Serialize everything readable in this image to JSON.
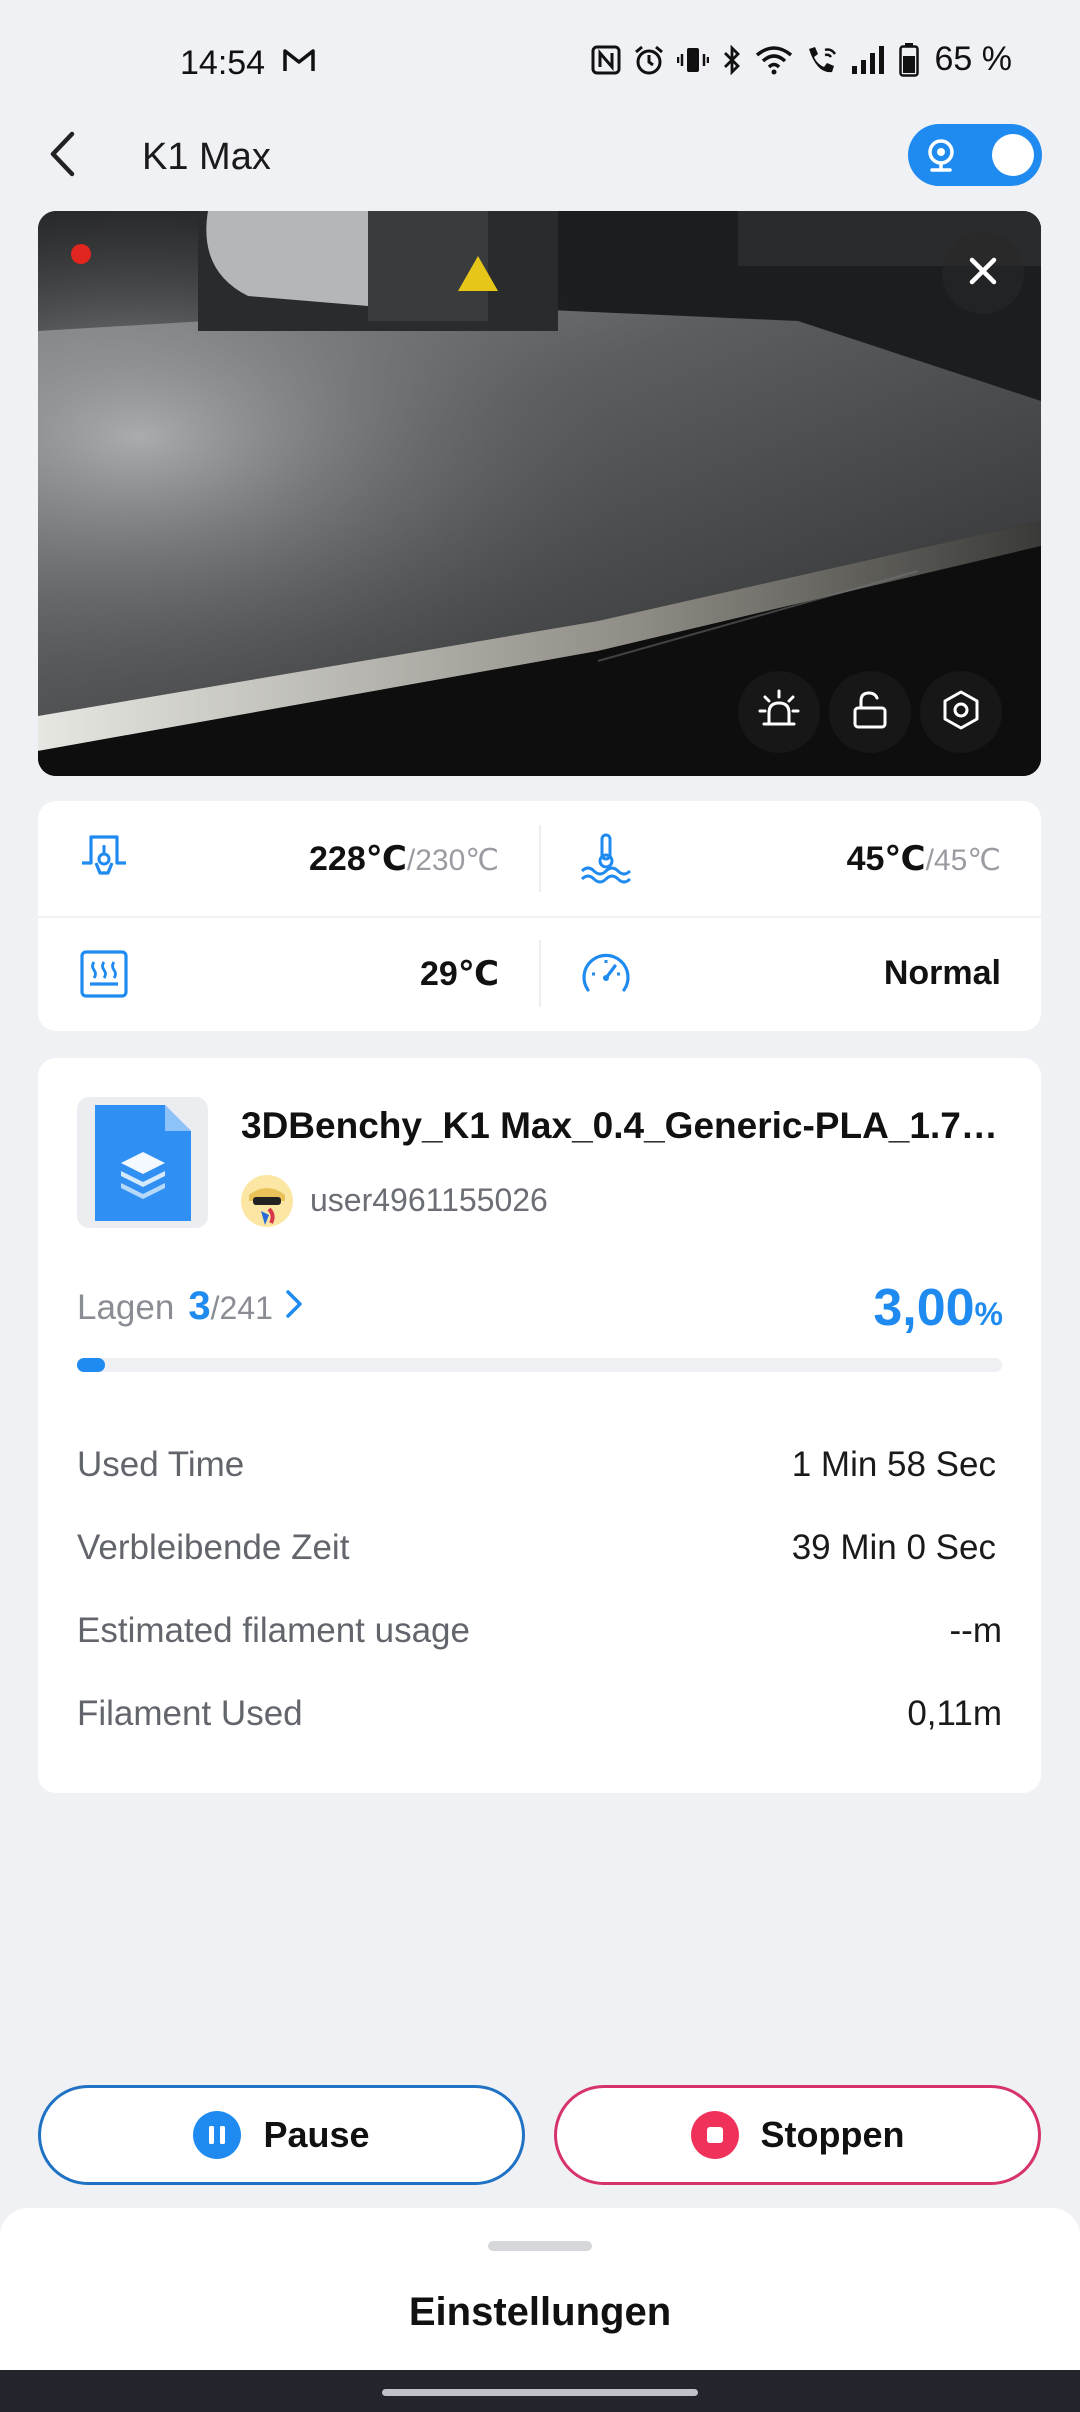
{
  "status_bar": {
    "time": "14:54",
    "battery": "65 %",
    "icons": [
      "gmail-icon",
      "nfc-icon",
      "alarm-icon",
      "vibrate-icon",
      "bluetooth-icon",
      "wifi-icon",
      "wifi-call-icon",
      "signal-icon",
      "battery-icon"
    ]
  },
  "header": {
    "title": "K1 Max",
    "camera_toggle_on": true
  },
  "camera": {
    "recording": true,
    "controls": [
      "light-icon",
      "lock-icon",
      "settings-icon"
    ]
  },
  "temps": {
    "nozzle": {
      "current": "228℃",
      "target": "/230℃"
    },
    "bed": {
      "current": "45℃",
      "target": "/45℃"
    },
    "chamber": {
      "current": "29℃"
    },
    "speed": {
      "mode": "Normal"
    }
  },
  "job": {
    "file_name": "3DBenchy_K1 Max_0.4_Generic-PLA_1.7…",
    "user": "user4961155026",
    "layers_label": "Lagen",
    "layer_current": "3",
    "layer_total": "/241",
    "percent_value": "3,00",
    "percent_unit": "%",
    "progress": 0.03,
    "stats": [
      {
        "label": "Used Time",
        "value": "1 Min  58 Sec"
      },
      {
        "label": "Verbleibende Zeit",
        "value": "39 Min  0 Sec"
      },
      {
        "label": "Estimated filament usage",
        "value": "--m"
      },
      {
        "label": "Filament Used",
        "value": "0,11m"
      }
    ]
  },
  "actions": {
    "pause_label": "Pause",
    "stop_label": "Stoppen"
  },
  "sheet": {
    "title": "Einstellungen"
  },
  "colors": {
    "accent": "#1f8bf0",
    "stop": "#f0325a",
    "background": "#f0f1f5"
  }
}
